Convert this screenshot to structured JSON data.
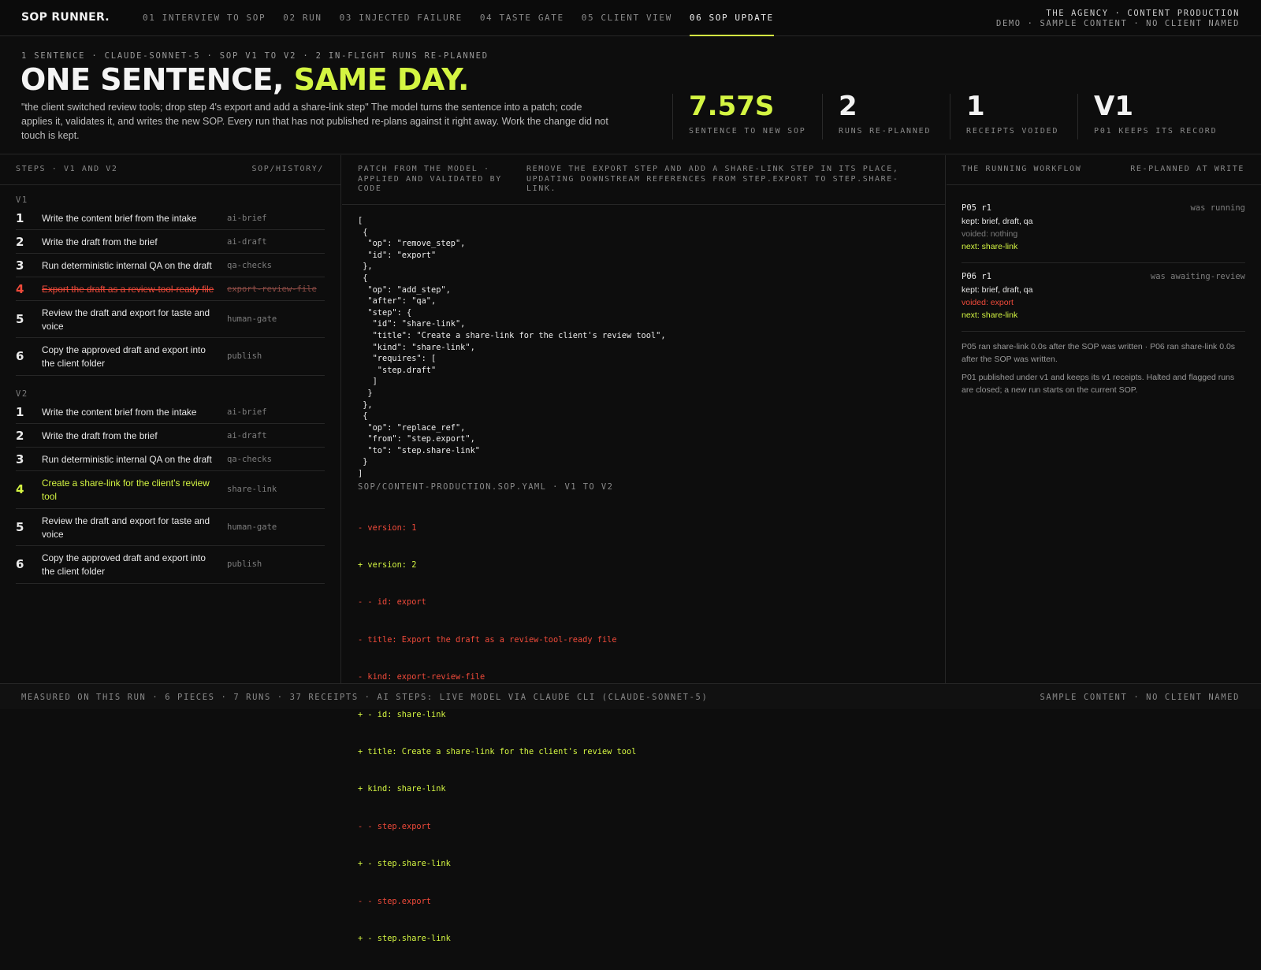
{
  "brand": "SOP RUNNER.",
  "nav": [
    {
      "label": "01 INTERVIEW TO SOP"
    },
    {
      "label": "02 RUN"
    },
    {
      "label": "03 INJECTED FAILURE"
    },
    {
      "label": "04 TASTE GATE"
    },
    {
      "label": "05 CLIENT VIEW"
    },
    {
      "label": "06 SOP UPDATE",
      "active": true
    }
  ],
  "top_right": {
    "line1": "THE AGENCY · CONTENT PRODUCTION",
    "line2": "DEMO · SAMPLE CONTENT · NO CLIENT NAMED"
  },
  "hero": {
    "kicker": "1 SENTENCE · CLAUDE-SONNET-5 · SOP V1 TO V2 · 2 IN-FLIGHT RUNS RE-PLANNED",
    "headline_main": "ONE SENTENCE, ",
    "headline_accent": "SAME DAY.",
    "description": "\"the client switched review tools; drop step 4's export and add a share-link step\" The model turns the sentence into a patch; code applies it, validates it, and writes the new SOP. Every run that has not published re-plans against it right away. Work the change did not touch is kept."
  },
  "stats": [
    {
      "value": "7.57S",
      "label": "SENTENCE TO NEW SOP",
      "accent": true
    },
    {
      "value": "2",
      "label": "RUNS RE-PLANNED"
    },
    {
      "value": "1",
      "label": "RECEIPTS VOIDED"
    },
    {
      "value": "V1",
      "label": "P01 KEEPS ITS RECORD"
    }
  ],
  "steps_panel": {
    "title": "STEPS · V1 AND V2",
    "path": "SOP/HISTORY/",
    "v1_label": "V1",
    "v2_label": "V2",
    "v1": [
      {
        "num": "1",
        "title": "Write the content brief from the intake",
        "kind": "ai-brief"
      },
      {
        "num": "2",
        "title": "Write the draft from the brief",
        "kind": "ai-draft"
      },
      {
        "num": "3",
        "title": "Run deterministic internal QA on the draft",
        "kind": "qa-checks"
      },
      {
        "num": "4",
        "title": "Export the draft as a review-tool-ready file",
        "kind": "export-review-file",
        "state": "removed"
      },
      {
        "num": "5",
        "title": "Review the draft and export for taste and voice",
        "kind": "human-gate"
      },
      {
        "num": "6",
        "title": "Copy the approved draft and export into the client folder",
        "kind": "publish"
      }
    ],
    "v2": [
      {
        "num": "1",
        "title": "Write the content brief from the intake",
        "kind": "ai-brief"
      },
      {
        "num": "2",
        "title": "Write the draft from the brief",
        "kind": "ai-draft"
      },
      {
        "num": "3",
        "title": "Run deterministic internal QA on the draft",
        "kind": "qa-checks"
      },
      {
        "num": "4",
        "title": "Create a share-link for the client's review tool",
        "kind": "share-link",
        "state": "added"
      },
      {
        "num": "5",
        "title": "Review the draft and export for taste and voice",
        "kind": "human-gate"
      },
      {
        "num": "6",
        "title": "Copy the approved draft and export into the client folder",
        "kind": "publish"
      }
    ]
  },
  "patch_panel": {
    "title": "PATCH FROM THE MODEL · APPLIED AND VALIDATED BY CODE",
    "summary": "REMOVE THE EXPORT STEP AND ADD A SHARE-LINK STEP IN ITS PLACE, UPDATING DOWNSTREAM REFERENCES FROM STEP.EXPORT TO STEP.SHARE-LINK.",
    "patch_json": "[\n {\n  \"op\": \"remove_step\",\n  \"id\": \"export\"\n },\n {\n  \"op\": \"add_step\",\n  \"after\": \"qa\",\n  \"step\": {\n   \"id\": \"share-link\",\n   \"title\": \"Create a share-link for the client's review tool\",\n   \"kind\": \"share-link\",\n   \"requires\": [\n    \"step.draft\"\n   ]\n  }\n },\n {\n  \"op\": \"replace_ref\",\n  \"from\": \"step.export\",\n  \"to\": \"step.share-link\"\n }\n]",
    "diff_title": "SOP/CONTENT-PRODUCTION.SOP.YAML · V1 TO V2",
    "diff": [
      {
        "type": "minus",
        "text": "- version: 1"
      },
      {
        "type": "plus",
        "text": "+ version: 2"
      },
      {
        "type": "minus",
        "text": "- - id: export"
      },
      {
        "type": "minus",
        "text": "- title: Export the draft as a review-tool-ready file"
      },
      {
        "type": "minus",
        "text": "- kind: export-review-file"
      },
      {
        "type": "plus",
        "text": "+ - id: share-link"
      },
      {
        "type": "plus",
        "text": "+ title: Create a share-link for the client's review tool"
      },
      {
        "type": "plus",
        "text": "+ kind: share-link"
      },
      {
        "type": "minus",
        "text": "- - step.export"
      },
      {
        "type": "plus",
        "text": "+ - step.share-link"
      },
      {
        "type": "minus",
        "text": "- - step.export"
      },
      {
        "type": "plus",
        "text": "+ - step.share-link"
      }
    ]
  },
  "workflow_panel": {
    "title": "THE RUNNING WORKFLOW",
    "subtitle": "RE-PLANNED AT WRITE",
    "runs": [
      {
        "id": "P05 r1",
        "status": "was running",
        "kept": "kept: brief, draft, qa",
        "voided": "voided: nothing",
        "voided_state": "muted",
        "next": "next: share-link"
      },
      {
        "id": "P06 r1",
        "status": "was awaiting-review",
        "kept": "kept: brief, draft, qa",
        "voided": "voided: export",
        "voided_state": "red",
        "next": "next: share-link"
      }
    ],
    "note1": "P05 ran share-link 0.0s after the SOP was written · P06 ran share-link 0.0s after the SOP was written.",
    "note2": "P01 published under v1 and keeps its v1 receipts. Halted and flagged runs are closed; a new run starts on the current SOP."
  },
  "footer": {
    "left": "MEASURED ON THIS RUN · 6 PIECES · 7 RUNS · 37 RECEIPTS · AI STEPS: LIVE MODEL VIA CLAUDE CLI (CLAUDE-SONNET-5)",
    "right": "SAMPLE CONTENT · NO CLIENT NAMED"
  },
  "colors": {
    "accent": "#d4f542",
    "removed": "#f04a3a",
    "background": "#0d0d0d"
  }
}
